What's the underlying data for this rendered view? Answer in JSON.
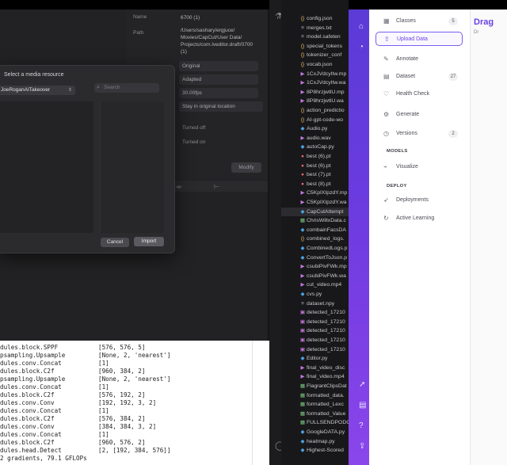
{
  "capcut": {
    "properties": [
      {
        "label": "Name",
        "value": "6700 (1)"
      },
      {
        "label": "Path",
        "value": "/Users/sashary/ergjuce/\nMovies/CapCut/User Data/\nProjects/com.lveditor.draft/0700\n(1)"
      }
    ],
    "selects": [
      "Original",
      "Adapted",
      "30.00fps",
      "Stay in original location"
    ],
    "toggles": [
      "Turned off",
      "Turned on"
    ],
    "modify_label": "Modify"
  },
  "modal": {
    "title": "Select a media resource",
    "path": "JoeRoganAITakeover",
    "search_placeholder": "Search",
    "search_icon": "search-icon",
    "cancel_label": "Cancel",
    "import_label": "Import"
  },
  "terminal": {
    "lines": [
      {
        "name": "dules.block.SPPF",
        "args": "[576, 576, 5]"
      },
      {
        "name": "psampling.Upsample",
        "args": "[None, 2, 'nearest']"
      },
      {
        "name": "dules.conv.Concat",
        "args": "[1]"
      },
      {
        "name": "dules.block.C2f",
        "args": "[960, 384, 2]"
      },
      {
        "name": "psampling.Upsample",
        "args": "[None, 2, 'nearest']"
      },
      {
        "name": "dules.conv.Concat",
        "args": "[1]"
      },
      {
        "name": "dules.block.C2f",
        "args": "[576, 192, 2]"
      },
      {
        "name": "dules.conv.Conv",
        "args": "[192, 192, 3, 2]"
      },
      {
        "name": "dules.conv.Concat",
        "args": "[1]"
      },
      {
        "name": "dules.block.C2f",
        "args": "[576, 384, 2]"
      },
      {
        "name": "dules.conv.Conv",
        "args": "[384, 384, 3, 2]"
      },
      {
        "name": "dules.conv.Concat",
        "args": "[1]"
      },
      {
        "name": "dules.block.C2f",
        "args": "[960, 576, 2]"
      },
      {
        "name": "dules.head.Detect",
        "args": "[2, [192, 384, 576]]"
      },
      {
        "name": "2 gradients, 79.1 GFLOPs",
        "args": ""
      }
    ]
  },
  "explorer": {
    "files": [
      {
        "icon": "{}",
        "color": "#e8c16b",
        "name": "config.json"
      },
      {
        "icon": "≡",
        "color": "#9aa4b2",
        "name": "merges.txt"
      },
      {
        "icon": "≡",
        "color": "#9aa4b2",
        "name": "model.safeten"
      },
      {
        "icon": "{}",
        "color": "#e8c16b",
        "name": "special_tokens"
      },
      {
        "icon": "{}",
        "color": "#e8c16b",
        "name": "tokenizer_conf"
      },
      {
        "icon": "{}",
        "color": "#e8c16b",
        "name": "vocab.json"
      },
      {
        "icon": "▶",
        "color": "#c678dd",
        "name": "1CxJVdcyItw.mp"
      },
      {
        "icon": "▶",
        "color": "#c678dd",
        "name": "1CxJVdcyItw.wa"
      },
      {
        "icon": "▶",
        "color": "#c678dd",
        "name": "8P8hrzjwtlU.mp"
      },
      {
        "icon": "▶",
        "color": "#c678dd",
        "name": "8P8hrzjwtlU.wa"
      },
      {
        "icon": "{}",
        "color": "#e8c16b",
        "name": "action_predictio"
      },
      {
        "icon": "{}",
        "color": "#e8c16b",
        "name": "AI-gpt-code-wo"
      },
      {
        "icon": "◆",
        "color": "#4fa3e0",
        "name": "Audio.py"
      },
      {
        "icon": "▶",
        "color": "#c678dd",
        "name": "audio.wav"
      },
      {
        "icon": "◆",
        "color": "#4fa3e0",
        "name": "autoCap.py"
      },
      {
        "icon": "●",
        "color": "#e06c75",
        "name": "best (6).pt"
      },
      {
        "icon": "●",
        "color": "#e06c75",
        "name": "best (6).pt"
      },
      {
        "icon": "●",
        "color": "#e06c75",
        "name": "best (7).pt"
      },
      {
        "icon": "●",
        "color": "#e06c75",
        "name": "best (8).pt"
      },
      {
        "icon": "▶",
        "color": "#c678dd",
        "name": "C5KpIXIpzdY.mp"
      },
      {
        "icon": "▶",
        "color": "#c678dd",
        "name": "C5KpIXIpzdY.wa"
      },
      {
        "icon": "◆",
        "color": "#4fa3e0",
        "name": "CapCutAttempt"
      },
      {
        "icon": "▦",
        "color": "#7fc97f",
        "name": "ChrisWillxData.c"
      },
      {
        "icon": "◆",
        "color": "#4fa3e0",
        "name": "combainFacsDA"
      },
      {
        "icon": "{}",
        "color": "#e8c16b",
        "name": "combined_logs."
      },
      {
        "icon": "◆",
        "color": "#4fa3e0",
        "name": "CombinedLogs.p"
      },
      {
        "icon": "◆",
        "color": "#4fa3e0",
        "name": "ConvertToJson.p"
      },
      {
        "icon": "▶",
        "color": "#c678dd",
        "name": "csubiPivFWk.mp"
      },
      {
        "icon": "▶",
        "color": "#c678dd",
        "name": "csubiPivFWk.wa"
      },
      {
        "icon": "▶",
        "color": "#c678dd",
        "name": "cut_video.mp4"
      },
      {
        "icon": "◆",
        "color": "#4fa3e0",
        "name": "cvs.py"
      },
      {
        "icon": "≡",
        "color": "#9aa4b2",
        "name": "dataset.npy"
      },
      {
        "icon": "▣",
        "color": "#c678dd",
        "name": "detected_17210"
      },
      {
        "icon": "▣",
        "color": "#c678dd",
        "name": "detected_17210"
      },
      {
        "icon": "▣",
        "color": "#c678dd",
        "name": "detected_17210"
      },
      {
        "icon": "▣",
        "color": "#c678dd",
        "name": "detected_17210"
      },
      {
        "icon": "▣",
        "color": "#c678dd",
        "name": "detected_17210"
      },
      {
        "icon": "◆",
        "color": "#4fa3e0",
        "name": "Editor.py"
      },
      {
        "icon": "▶",
        "color": "#c678dd",
        "name": "final_video_disc"
      },
      {
        "icon": "▶",
        "color": "#c678dd",
        "name": "final_video.mp4"
      },
      {
        "icon": "▦",
        "color": "#7fc97f",
        "name": "FlagrantClipsDat"
      },
      {
        "icon": "▦",
        "color": "#7fc97f",
        "name": "formatted_data."
      },
      {
        "icon": "▦",
        "color": "#7fc97f",
        "name": "formatted_Lexc"
      },
      {
        "icon": "▦",
        "color": "#7fc97f",
        "name": "formatted_Value"
      },
      {
        "icon": "▦",
        "color": "#7fc97f",
        "name": "FULLSENDPODC"
      },
      {
        "icon": "◆",
        "color": "#4fa3e0",
        "name": "GoogleDATA.py"
      },
      {
        "icon": "◆",
        "color": "#4fa3e0",
        "name": "heatmap.py"
      },
      {
        "icon": "◆",
        "color": "#4fa3e0",
        "name": "Highest-Scored"
      }
    ]
  },
  "nav": {
    "items": [
      {
        "icon": "grid-icon",
        "glyph": "▦",
        "label": "Classes",
        "count": "5"
      },
      {
        "icon": "upload-icon",
        "glyph": "⇧",
        "label": "Upload Data",
        "count": "",
        "active": true
      },
      {
        "icon": "annotate-icon",
        "glyph": "✎",
        "label": "Annotate",
        "count": ""
      },
      {
        "icon": "dataset-icon",
        "glyph": "▤",
        "label": "Dataset",
        "count": "27"
      },
      {
        "icon": "health-icon",
        "glyph": "♡",
        "label": "Health Check",
        "count": ""
      },
      {
        "icon": "generate-icon",
        "glyph": "⚙",
        "label": "Generate",
        "count": ""
      },
      {
        "icon": "versions-icon",
        "glyph": "◷",
        "label": "Versions",
        "count": "2"
      }
    ],
    "models_label": "MODELS",
    "visualize_label": "Visualize",
    "deploy_label": "DEPLOY",
    "deployments_label": "Deployments",
    "active_learning_label": "Active Learning"
  },
  "content": {
    "title": "Drag",
    "chip": "Dr"
  },
  "colors": {
    "accent": "#6a40e6"
  }
}
